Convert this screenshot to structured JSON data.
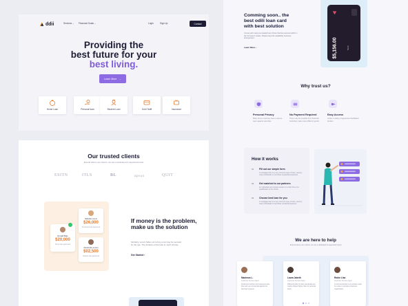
{
  "hero": {
    "logo_text": "ddii",
    "nav": {
      "services": "Services ⌄",
      "financial_goals": "Financial Goals ⌄",
      "login": "Login",
      "signup": "Sign Up",
      "contact": "Contact"
    },
    "title_line1": "Providing the",
    "title_line2": "best future for your",
    "title_accent": "best living.",
    "cta": "Learn More",
    "cta_arrow": "→",
    "loans": [
      "Home Loan",
      "Personal loan",
      "Student Loan",
      "Gold Tariff",
      "Insurance"
    ]
  },
  "clients": {
    "title": "Our trusted clients",
    "subtitle": "Extend about your clients, we are a dedicated & supported brand",
    "brands": [
      "ESITN",
      "ITLS",
      "BL",
      "apvus",
      "QUIT"
    ]
  },
  "money": {
    "heading": "If money is the problem, make us the solution",
    "paragraph": "Similarly, Lorem fallen out to buy a car may be secured by the use. The duration of the loan is much shorter.",
    "link": "Get Started",
    "link_arrow": "›",
    "cards": [
      {
        "name": "Isabella Lorem",
        "amount": "$26,000",
        "note": "Personal Loan approved"
      },
      {
        "name": "Ronald Bale",
        "amount": "$20,000",
        "note": "Home loan approved"
      },
      {
        "name": "Alexander Lorem",
        "amount": "$02,500",
        "note": "Student loan approved"
      }
    ]
  },
  "card_promo": {
    "title_line1": "Comming soon.. the",
    "title_line2": "best odili loan card",
    "title_line3": "with best solution",
    "paragraph": "Comes with many pre-loaded loan choice that fast secured within in the borrower's assets. Please keep the availability business arrangement.",
    "link": "Learn More",
    "link_arrow": "›",
    "card_amount": "$5,156.00",
    "card_digits": "5020"
  },
  "trust": {
    "title": "Why trust us?",
    "features": [
      {
        "title": "Personal Privacy",
        "text": "Many forms of privacy have a secure open against securities"
      },
      {
        "title": "No Payment Required",
        "text": "There may be possible from financial institution make many different goods"
      },
      {
        "title": "Easy Access",
        "text": "Under a variety of agreement facilitated lenders"
      }
    ]
  },
  "how": {
    "title": "How it works",
    "steps": [
      {
        "num": "01",
        "title": "Fill out our simple form",
        "text": "A mortgage loan is a very common type of loan, used by many individuals to purchase residential properties."
      },
      {
        "num": "02",
        "title": "Get matched to our partners",
        "text": "An individual can provide access in a short time of a qualification to the lender."
      },
      {
        "num": "03",
        "title": "Choose best loan for you",
        "text": "A mortgage loan is a very common type of loan, used by many individuals to purchase residential property."
      }
    ]
  },
  "help": {
    "title": "We are here to help",
    "subtitle": "Extend about your clients, we are a dedicated & supported brand",
    "people": [
      {
        "name": "Maximus L.",
        "role": "Customer Service Agent",
        "text": "Small and medium-size business loans that such as commercial against the borrower's assets."
      },
      {
        "name": "Laura Jabeth",
        "role": "Customer Service Agent",
        "text": "Different kinds of loans specifically are mainly obliged higher than for personal loans."
      },
      {
        "name": "Robin Lisa",
        "role": "Customer Service Agent",
        "text": "A commercial loan is a contract made by a loan to provide a business organization."
      }
    ]
  },
  "colors": {
    "accent_purple": "#8C6BE3",
    "dark": "#1C1C35",
    "orange": "#E6782A",
    "peach": "#FDF0E2"
  }
}
